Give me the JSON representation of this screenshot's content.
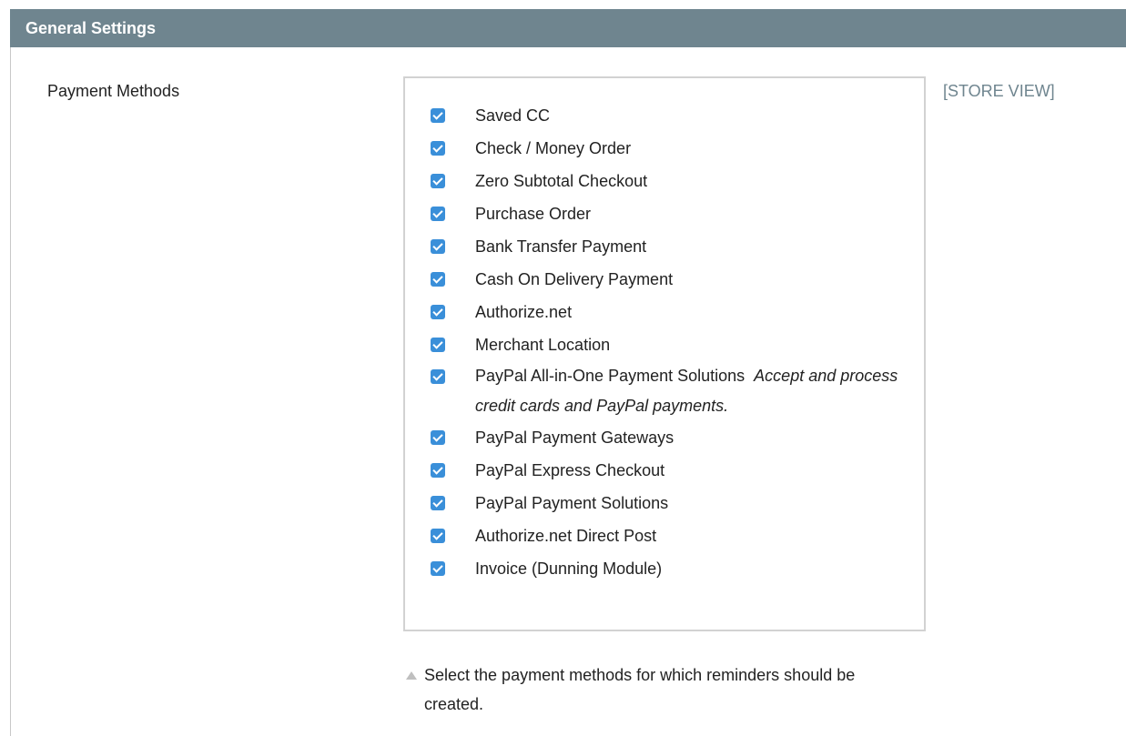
{
  "section": {
    "title": "General Settings"
  },
  "field": {
    "label": "Payment Methods",
    "scope": "[STORE VIEW]",
    "hint": "Select the payment methods for which reminders should be created."
  },
  "options": [
    {
      "label": "Saved CC",
      "checked": true
    },
    {
      "label": "Check / Money Order",
      "checked": true
    },
    {
      "label": "Zero Subtotal Checkout",
      "checked": true
    },
    {
      "label": "Purchase Order",
      "checked": true
    },
    {
      "label": "Bank Transfer Payment",
      "checked": true
    },
    {
      "label": "Cash On Delivery Payment",
      "checked": true
    },
    {
      "label": "Authorize.net",
      "checked": true
    },
    {
      "label": "Merchant Location",
      "checked": true
    },
    {
      "label": "PayPal All-in-One Payment Solutions",
      "description": "Accept and process credit cards and PayPal payments.",
      "checked": true
    },
    {
      "label": "PayPal Payment Gateways",
      "checked": true
    },
    {
      "label": "PayPal Express Checkout",
      "checked": true
    },
    {
      "label": "PayPal Payment Solutions",
      "checked": true
    },
    {
      "label": "Authorize.net Direct Post",
      "checked": true
    },
    {
      "label": "Invoice (Dunning Module)",
      "checked": true
    }
  ],
  "colors": {
    "header_bg": "#6f858f",
    "checkbox": "#3a8fd9",
    "scope_text": "#6f858f"
  }
}
